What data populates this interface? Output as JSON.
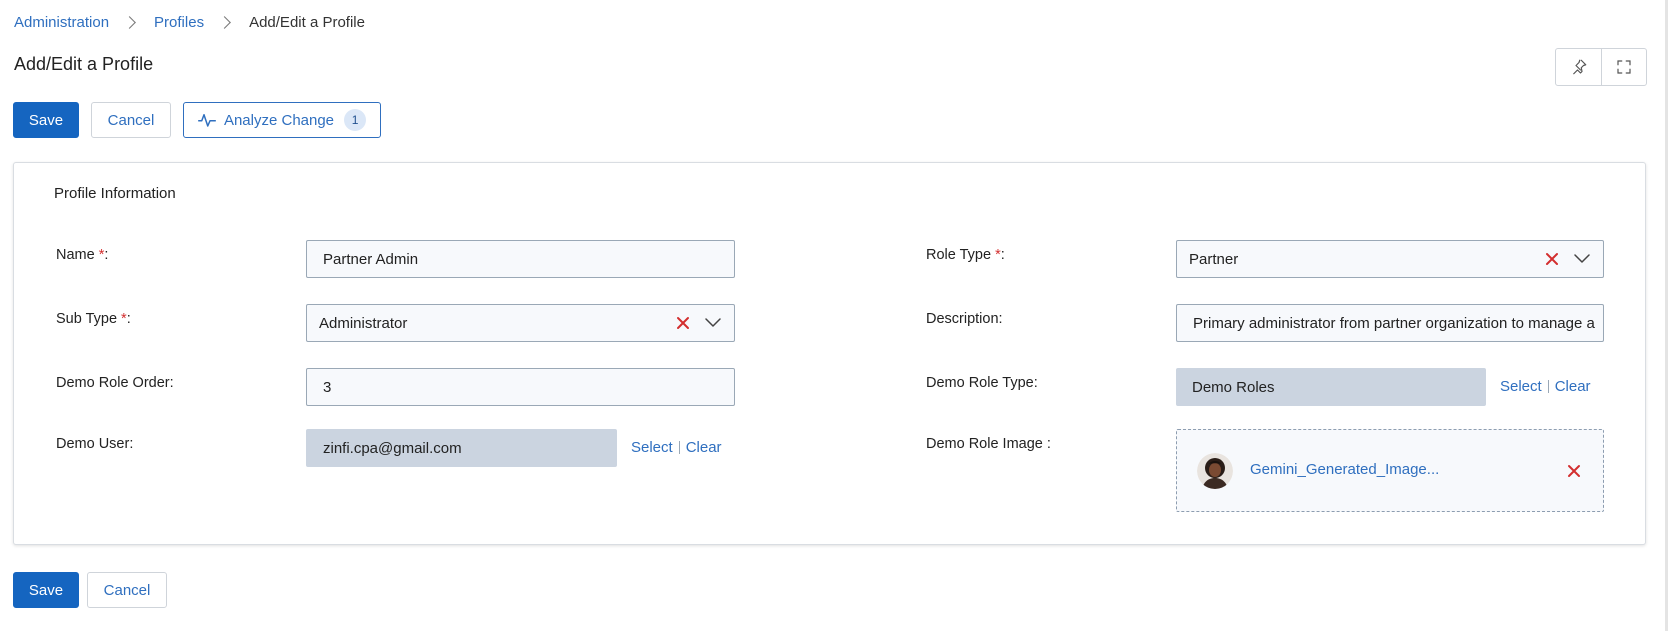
{
  "breadcrumb": {
    "items": [
      "Administration",
      "Profiles"
    ],
    "current": "Add/Edit a Profile"
  },
  "page": {
    "title": "Add/Edit a Profile"
  },
  "toolbar": {
    "save_label": "Save",
    "cancel_label": "Cancel",
    "analyze_label": "Analyze Change",
    "analyze_count": "1",
    "pin_icon": "pin-icon",
    "fullscreen_icon": "fullscreen-icon"
  },
  "form": {
    "section_title": "Profile Information",
    "required_marker": "*",
    "name": {
      "label": "Name",
      "value": "Partner Admin"
    },
    "role_type": {
      "label": "Role Type",
      "value": "Partner"
    },
    "sub_type": {
      "label": "Sub Type",
      "value": "Administrator"
    },
    "description": {
      "label": "Description:",
      "value": "Primary administrator from partner organization to manage a"
    },
    "demo_role_order": {
      "label": "Demo Role Order:",
      "value": "3"
    },
    "demo_role_type": {
      "label": "Demo Role Type:",
      "value": "Demo Roles",
      "select_label": "Select",
      "clear_label": "Clear"
    },
    "demo_user": {
      "label": "Demo User:",
      "value": "zinfi.cpa@gmail.com",
      "select_label": "Select",
      "clear_label": "Clear"
    },
    "demo_role_image": {
      "label": "Demo Role Image :",
      "file_name": "Gemini_Generated_Image..."
    }
  },
  "footer": {
    "save_label": "Save",
    "cancel_label": "Cancel"
  },
  "colors": {
    "primary": "#1565c0",
    "link": "#2f6fbf",
    "required": "#d32f2f",
    "readonly_field": "#cbd4e0",
    "field_bg": "#f7f9fc"
  }
}
